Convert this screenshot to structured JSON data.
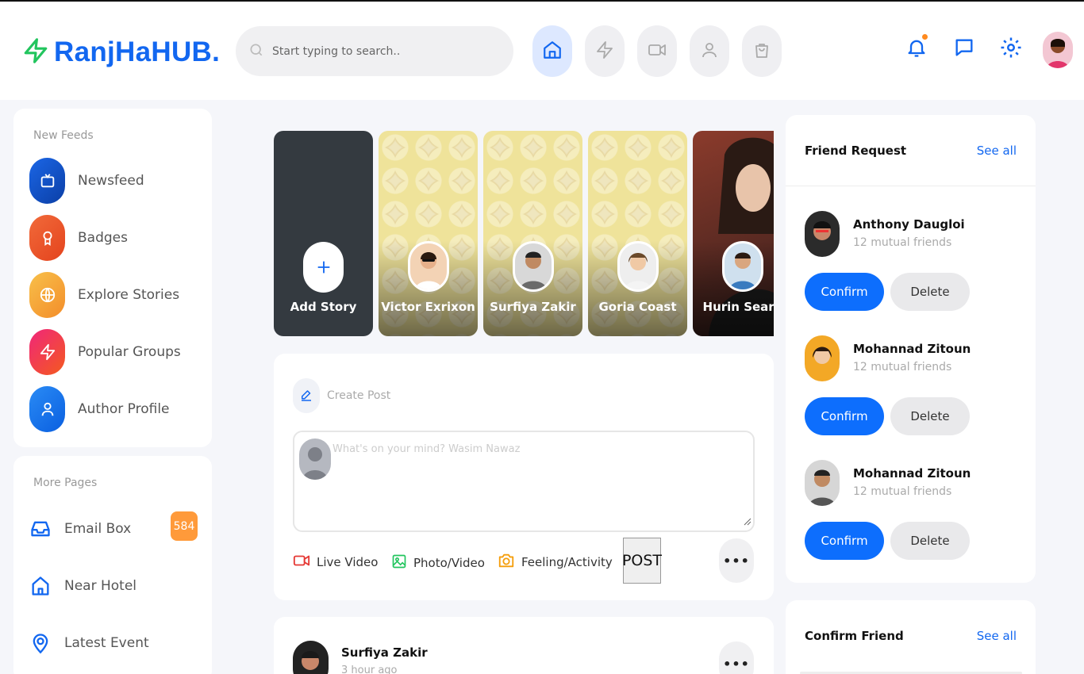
{
  "brand": {
    "name": "RanjHaHUB.",
    "accent": "#1267f0",
    "logo_icon": "lightning-bolt-icon",
    "logo_icon_color": "#22c55e"
  },
  "search": {
    "placeholder": "Start typing to search..",
    "icon": "search-icon"
  },
  "top_nav": [
    {
      "name": "home",
      "icon": "home-icon",
      "active": true
    },
    {
      "name": "lightning",
      "icon": "lightning-icon",
      "active": false
    },
    {
      "name": "video",
      "icon": "video-icon",
      "active": false
    },
    {
      "name": "user",
      "icon": "user-icon",
      "active": false
    },
    {
      "name": "shop",
      "icon": "shopping-bag-icon",
      "active": false
    }
  ],
  "header_icons": [
    "bell-icon",
    "chat-icon",
    "settings-gear-icon",
    "profile-avatar"
  ],
  "sidebar": {
    "section1_title": "New Feeds",
    "items": [
      {
        "label": "Newsfeed",
        "icon": "tv-icon",
        "color": "#1b5bd6"
      },
      {
        "label": "Badges",
        "icon": "award-icon",
        "color": "#f0562b"
      },
      {
        "label": "Explore Stories",
        "icon": "globe-icon",
        "color": "#f4a72b"
      },
      {
        "label": "Popular Groups",
        "icon": "lightning-icon",
        "color": "#ee1f6f"
      },
      {
        "label": "Author Profile",
        "icon": "user-icon",
        "color": "#1274f0"
      }
    ],
    "section2_title": "More Pages",
    "pages": [
      {
        "label": "Email Box",
        "icon": "inbox-icon",
        "badge": "584"
      },
      {
        "label": "Near Hotel",
        "icon": "home-icon"
      },
      {
        "label": "Latest Event",
        "icon": "map-pin-icon"
      }
    ]
  },
  "stories": {
    "add_label": "Add Story",
    "items": [
      {
        "name": "Victor Exrixon"
      },
      {
        "name": "Surfiya Zakir"
      },
      {
        "name": "Goria Coast"
      },
      {
        "name": "Hurin Seary"
      }
    ]
  },
  "create_post": {
    "title": "Create Post",
    "placeholder": "What's on your mind? Wasim Nawaz",
    "actions": [
      {
        "label": "Live Video",
        "icon": "video-icon",
        "color": "#e53935"
      },
      {
        "label": "Photo/Video",
        "icon": "image-icon",
        "color": "#22c55e"
      },
      {
        "label": "Feeling/Activity",
        "icon": "camera-icon",
        "color": "#f59e0b"
      }
    ],
    "post_button": "POST",
    "more": "•••"
  },
  "feed": {
    "author": "Surfiya Zakir",
    "time": "3 hour ago",
    "more": "•••"
  },
  "friend_request": {
    "title": "Friend Request",
    "see_all": "See all",
    "requests": [
      {
        "name": "Anthony Daugloi",
        "mutual": "12 mutual friends",
        "confirm": "Confirm",
        "delete": "Delete"
      },
      {
        "name": "Mohannad Zitoun",
        "mutual": "12 mutual friends",
        "confirm": "Confirm",
        "delete": "Delete"
      },
      {
        "name": "Mohannad Zitoun",
        "mutual": "12 mutual friends",
        "confirm": "Confirm",
        "delete": "Delete"
      }
    ]
  },
  "confirm_friend": {
    "title": "Confirm Friend",
    "see_all": "See all"
  }
}
